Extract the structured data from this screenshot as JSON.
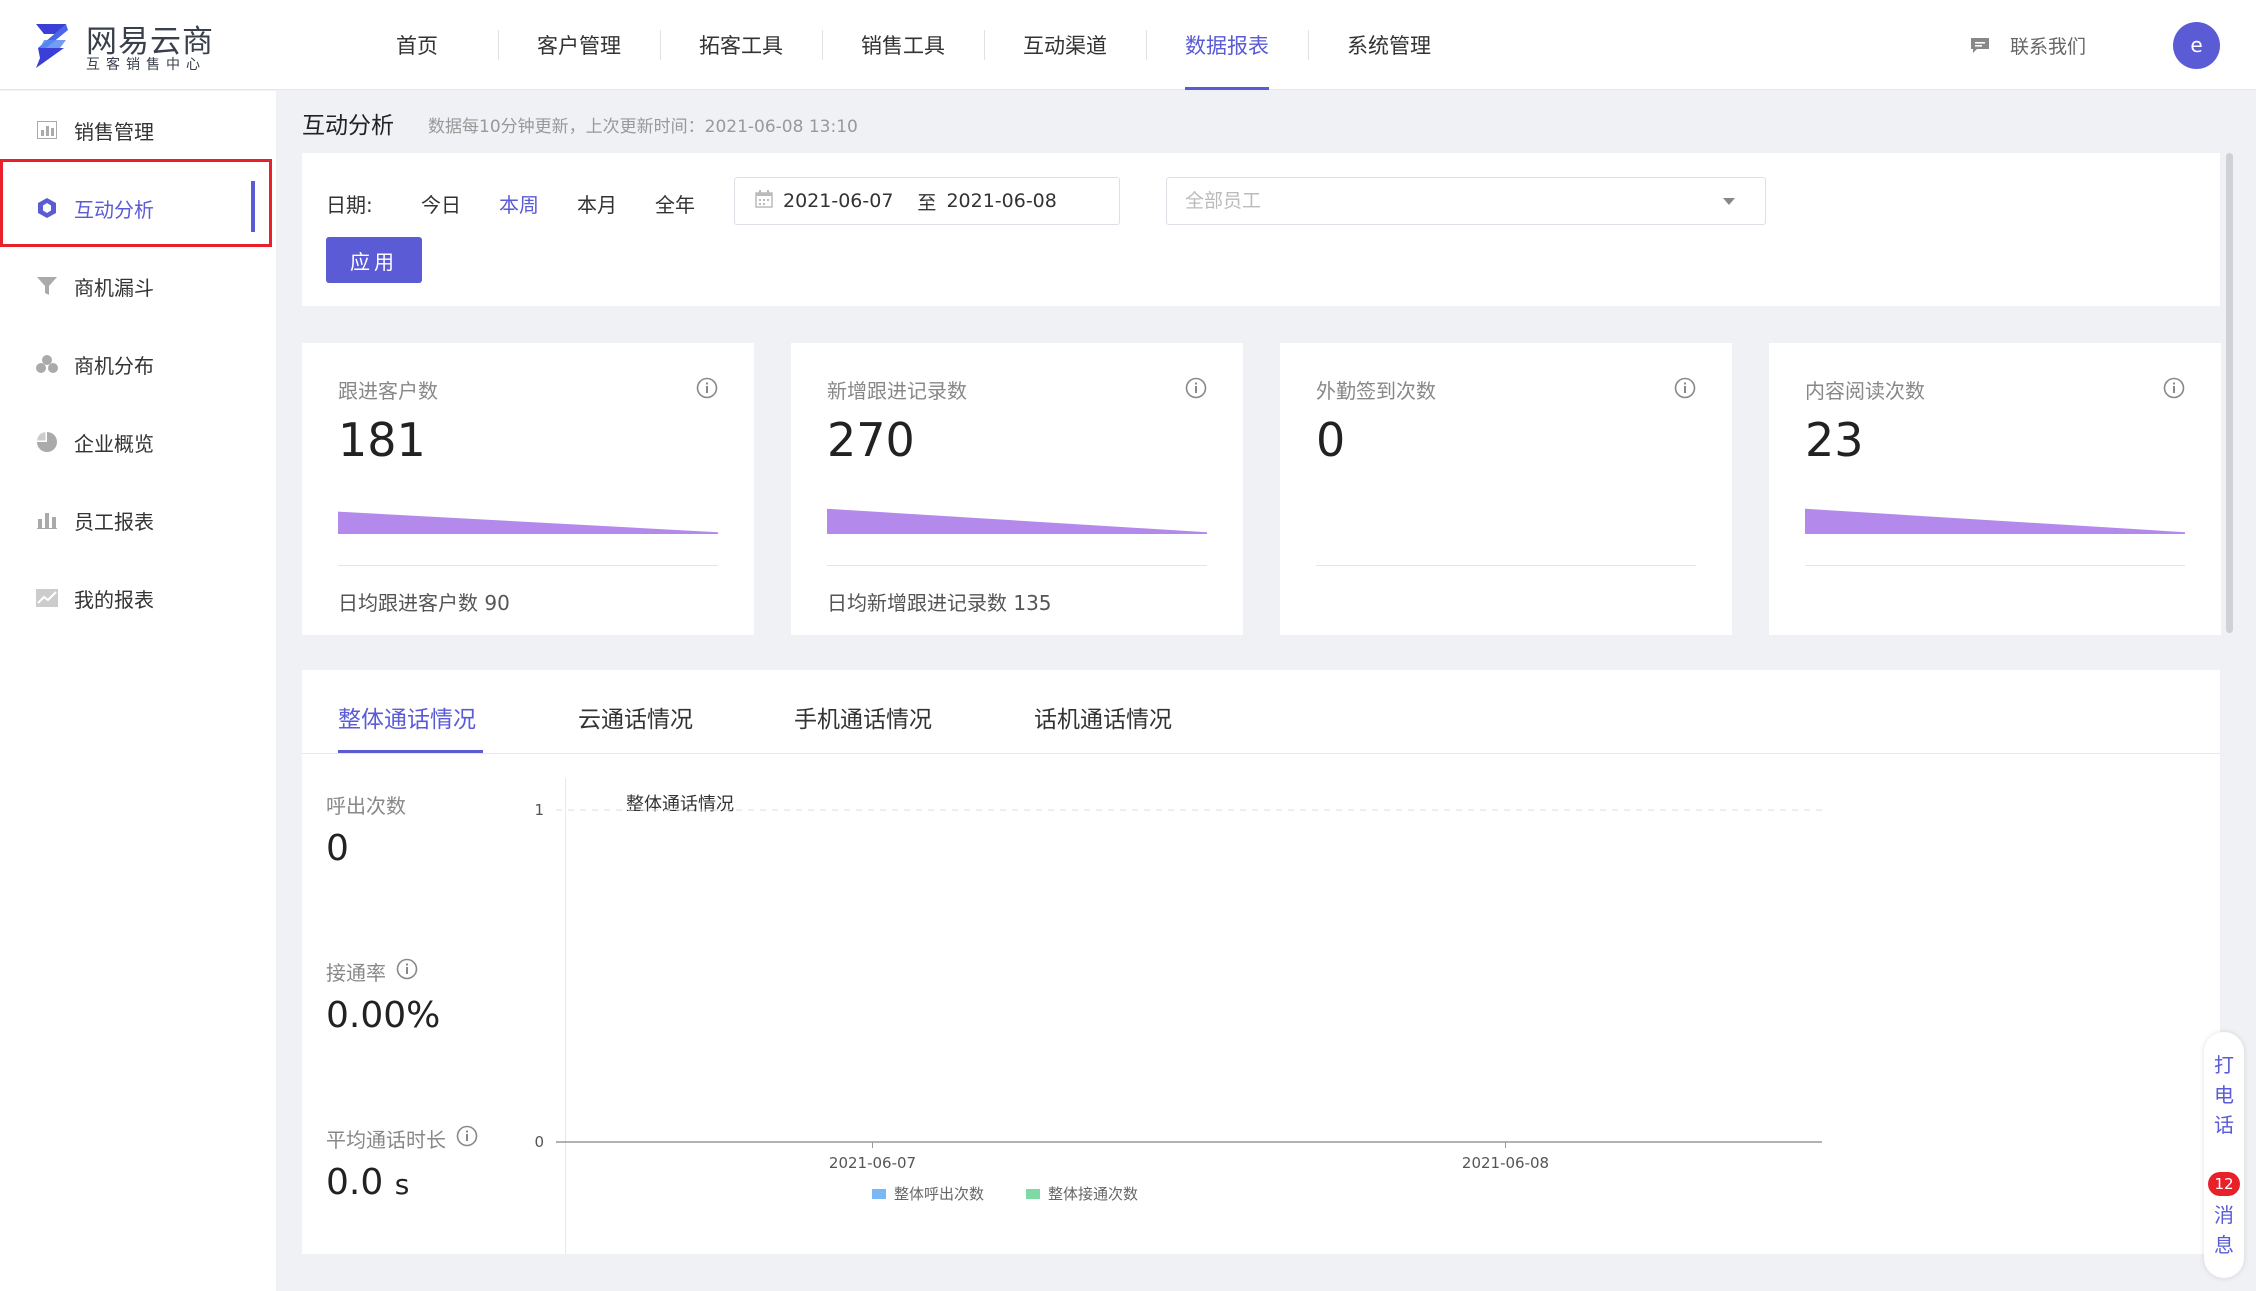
{
  "brand": {
    "name": "网易云商",
    "subtitle": "互客销售中心",
    "color": "#3b3fd8"
  },
  "topnav": {
    "items": [
      "首页",
      "客户管理",
      "拓客工具",
      "销售工具",
      "互动渠道",
      "数据报表",
      "系统管理"
    ],
    "active": "数据报表",
    "contact_label": "联系我们",
    "avatar_letter": "e"
  },
  "sidebar": {
    "items": [
      {
        "label": "销售管理",
        "icon": "bar-chart-icon"
      },
      {
        "label": "互动分析",
        "icon": "cube-icon"
      },
      {
        "label": "商机漏斗",
        "icon": "funnel-icon"
      },
      {
        "label": "商机分布",
        "icon": "cluster-icon"
      },
      {
        "label": "企业概览",
        "icon": "pie-icon"
      },
      {
        "label": "员工报表",
        "icon": "bar-chart-icon"
      },
      {
        "label": "我的报表",
        "icon": "line-chart-icon"
      }
    ],
    "active": "互动分析"
  },
  "page": {
    "title": "互动分析",
    "update_note": "数据每10分钟更新，上次更新时间：2021-06-08 13:10"
  },
  "filter": {
    "date_label": "日期:",
    "options": [
      "今日",
      "本周",
      "本月",
      "全年"
    ],
    "active_option": "本周",
    "date_from": "2021-06-07",
    "date_sep": "至",
    "date_to": "2021-06-08",
    "employee_placeholder": "全部员工",
    "apply_label": "应用"
  },
  "kpis": [
    {
      "title": "跟进客户数",
      "value": "181",
      "footer": "日均跟进客户数 90",
      "spark": [
        0.62,
        0.05
      ],
      "show_spark": true
    },
    {
      "title": "新增跟进记录数",
      "value": "270",
      "footer": "日均新增跟进记录数 135",
      "spark": [
        0.7,
        0.05
      ],
      "show_spark": true
    },
    {
      "title": "外勤签到次数",
      "value": "0",
      "footer": "",
      "spark": [
        0,
        0
      ],
      "show_spark": false
    },
    {
      "title": "内容阅读次数",
      "value": "23",
      "footer": "",
      "spark": [
        0.7,
        0.05
      ],
      "show_spark": true
    }
  ],
  "call": {
    "tabs": [
      "整体通话情况",
      "云通话情况",
      "手机通话情况",
      "话机通话情况"
    ],
    "active_tab": "整体通话情况",
    "stats": [
      {
        "label": "呼出次数",
        "value": "0",
        "unit": "",
        "info": false
      },
      {
        "label": "接通率",
        "value": "0.00%",
        "unit": "",
        "info": true
      },
      {
        "label": "平均通话时长",
        "value": "0.0",
        "unit": "s",
        "info": true
      }
    ]
  },
  "chart_data": {
    "type": "bar",
    "title": "整体通话情况",
    "categories": [
      "2021-06-07",
      "2021-06-08"
    ],
    "series": [
      {
        "name": "整体呼出次数",
        "values": [
          0,
          0
        ],
        "color": "#7ab8f5"
      },
      {
        "name": "整体接通次数",
        "values": [
          0,
          0
        ],
        "color": "#7fd9a4"
      }
    ],
    "ylim": [
      0,
      1
    ],
    "yticks": [
      "0",
      "1"
    ],
    "legend": "bottom-center",
    "grid": true
  },
  "float": {
    "call_label": "打电话",
    "msg_label": "消息",
    "msg_count": "12"
  },
  "colors": {
    "accent": "#5b5bd6",
    "highlight_border": "#e8202a",
    "spark_fill": "#b38aec"
  }
}
